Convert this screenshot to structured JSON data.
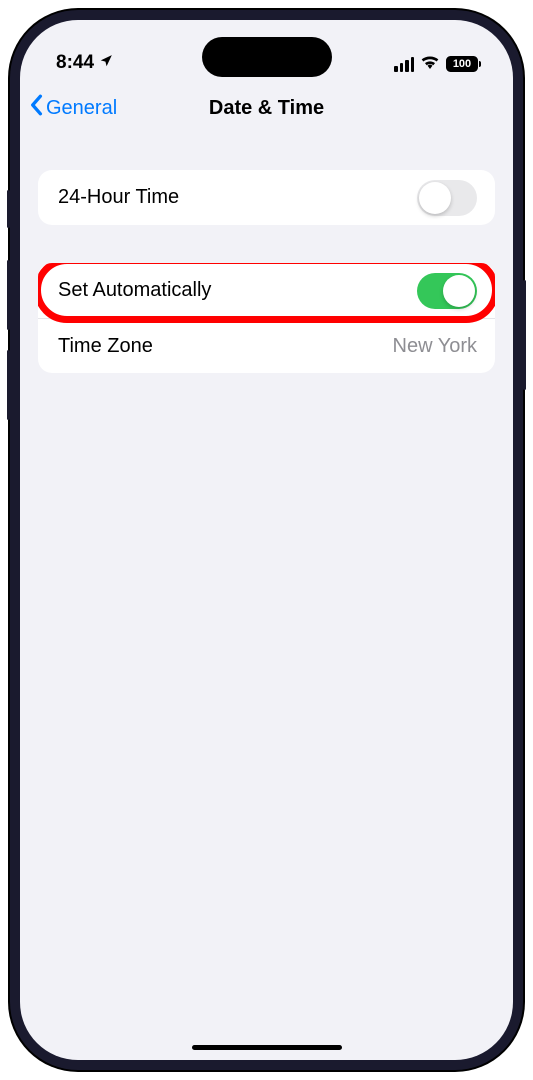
{
  "status_bar": {
    "time": "8:44",
    "battery_level": "100"
  },
  "nav": {
    "back_label": "General",
    "title": "Date & Time"
  },
  "settings": {
    "group1": {
      "twentyfour_hour_label": "24-Hour Time",
      "twentyfour_hour_on": false
    },
    "group2": {
      "set_auto_label": "Set Automatically",
      "set_auto_on": true,
      "timezone_label": "Time Zone",
      "timezone_value": "New York"
    }
  }
}
